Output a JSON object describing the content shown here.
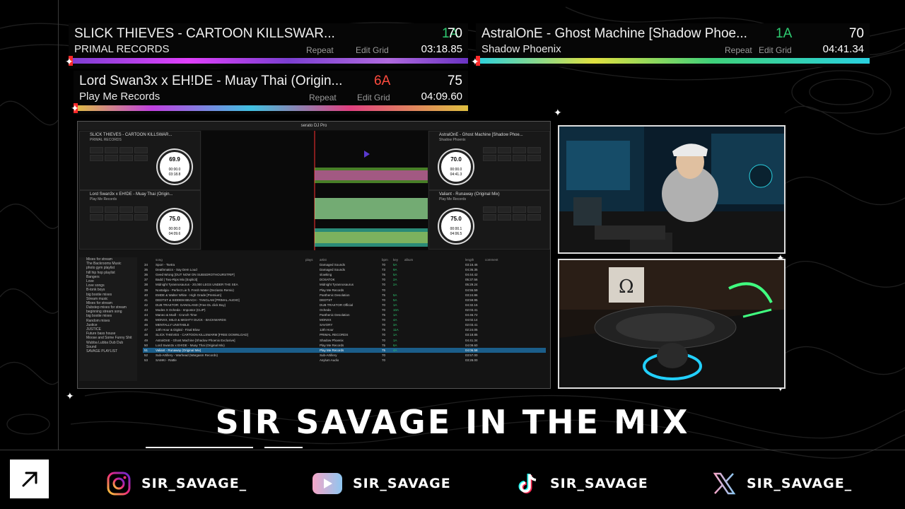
{
  "decks_overlay": [
    {
      "title": "SLICK THIEVES - CARTOON KILLSWAR...",
      "key": "1A",
      "key_color": "#2ecc71",
      "bpm": "70",
      "label": "PRIMAL RECORDS",
      "repeat": "Repeat",
      "edit_grid": "Edit Grid",
      "time": "03:18.85"
    },
    {
      "title": "AstralOnE - Ghost Machine  [Shadow Phoe...",
      "key": "1A",
      "key_color": "#2ecc71",
      "bpm": "70",
      "label": "Shadow Phoenix",
      "repeat": "Repeat",
      "edit_grid": "Edit Grid",
      "time": "04:41.34"
    },
    {
      "title": "Lord Swan3x x EH!DE - Muay Thai (Origin...",
      "key": "6A",
      "key_color": "#ff4b3e",
      "bpm": "75",
      "label": "Play Me Records",
      "repeat": "Repeat",
      "edit_grid": "Edit Grid",
      "time": "04:09.60"
    }
  ],
  "serato": {
    "app_title": "serato DJ Pro",
    "decks": [
      {
        "title": "SLICK THIEVES - CARTOON KILLSWAR...",
        "label": "PRIMAL RECORDS",
        "bpm": "70",
        "key": "1A",
        "platter_bpm": "69.9",
        "elapsed": "00:00.0",
        "remaining": "03:18.8"
      },
      {
        "title": "AstralOnE - Ghost Machine  [Shadow Phoe...",
        "label": "Shadow Phoenix",
        "bpm": "70",
        "key": "1A",
        "platter_bpm": "70.0",
        "elapsed": "00:00.0",
        "remaining": "04:41.3"
      },
      {
        "title": "Lord Swan3x x EH!DE - Muay Thai (Origin...",
        "label": "Play Me Records",
        "bpm": "75",
        "key": "6A",
        "platter_bpm": "75.0",
        "elapsed": "00:00.0",
        "remaining": "04:09.6"
      },
      {
        "title": "Valiant - Runaway (Original Mix)",
        "label": "Play Me Records",
        "bpm": "75",
        "key": "4A",
        "platter_bpm": "75.0",
        "elapsed": "00:00.1",
        "remaining": "04:06.5"
      }
    ],
    "crates": [
      "Mixes for stream",
      "The Backrooms Music",
      "photo gym playlist",
      "hill hip hop playlist",
      "Bangers",
      "Love",
      "Love songs",
      "B-tonk boys",
      "big bootie mixes",
      "Stream music",
      "Mixes for stream",
      "Dubstep mixes for stream",
      "beginning stream song",
      "big bootie mixes",
      "Random mixes",
      "Justice",
      "JUSTICE",
      "Future bass house",
      "Moose and Some Funny Shit",
      "Wubba Lubba Dub Dub",
      "Sound",
      "SAVAGE PLAYLIST"
    ],
    "columns": {
      "song": "song",
      "plays": "plays",
      "artist": "artist",
      "bpm": "bpm",
      "key": "key",
      "album": "album",
      "length": "length",
      "comment": "comment"
    },
    "tracks": [
      {
        "n": "34",
        "song": "Sporr - Tsetra",
        "artist": "Damaged Sounds",
        "bpm": "70",
        "key": "5A",
        "length": "03:16.46"
      },
      {
        "n": "35",
        "song": "Deathmatics - Say Dem Loud",
        "artist": "Damaged Sounds",
        "bpm": "73",
        "key": "9A",
        "length": "04:36.35"
      },
      {
        "n": "36",
        "song": "Geed Wrong [OUT NOW ON SUBSDROTHOURSTRIP]",
        "artist": "slowking",
        "bpm": "76",
        "key": "5A",
        "length": "04:44.42"
      },
      {
        "n": "37",
        "song": "Badd | Two-Rips Mix [Explicit]",
        "artist": "DOSATOK",
        "bpm": "70",
        "key": "2A",
        "length": "05:37.56"
      },
      {
        "n": "38",
        "song": "Midnight Tyrannosaurus - 20,000 LEGS UNDER THE SEA",
        "artist": "Midnight Tyrannosaurus",
        "bpm": "70",
        "key": "2A",
        "length": "05:29.24"
      },
      {
        "n": "39",
        "song": "Nostalgia - Perfect Lie ft. Fresh Water (Deziasto Remix)",
        "artist": "Play Me Records",
        "bpm": "70",
        "key": "",
        "length": "04:55.59"
      },
      {
        "n": "40",
        "song": "EMDE & Walter White - High Grade [Premium]",
        "artist": "Panthenic Desolation",
        "bpm": "75",
        "key": "5A",
        "length": "03:24.86"
      },
      {
        "n": "41",
        "song": "DEDTST & SIDDEM BEACH - TANGLAM [PRIMAL AUDIO]",
        "artist": "DEDTST",
        "bpm": "70",
        "key": "5A",
        "length": "03:59.95"
      },
      {
        "n": "42",
        "song": "DUB TRAKTOR: GANGLAND (Free DL click Buy)",
        "artist": "DUB TRAKTOR Official",
        "bpm": "70",
        "key": "1A",
        "length": "04:32.15"
      },
      {
        "n": "43",
        "song": "Modes X Ocheda - Impostor (CLIP)",
        "artist": "Ocheda",
        "bpm": "70",
        "key": "10A",
        "length": "02:03.41"
      },
      {
        "n": "44",
        "song": "Maneo & Modl - Crunch Time",
        "artist": "Panthenic Desolation",
        "bpm": "75",
        "key": "1A",
        "length": "04:46.72"
      },
      {
        "n": "45",
        "song": "MONXX, MILO & MIGHTY DUCK - BACKWARDS",
        "artist": "MONXX",
        "bpm": "70",
        "key": "4A",
        "length": "04:02.14"
      },
      {
        "n": "46",
        "song": "MENTALLY UNSTABLE",
        "artist": "SAVORY",
        "bpm": "70",
        "key": "3A",
        "length": "02:03.41"
      },
      {
        "n": "47",
        "song": "12th Hour & Digital - Final Blow",
        "artist": "12th Hour",
        "bpm": "75",
        "key": "11A",
        "length": "02:24.05"
      },
      {
        "n": "48",
        "song": "SLICK THIEVES - CARTOON KILLSWARM [FREE DOWNLOAD]",
        "artist": "PRIMAL RECORDS",
        "bpm": "70",
        "key": "1A",
        "length": "03:18.85"
      },
      {
        "n": "49",
        "song": "AstralOnE - Ghost Machine [Shadow Phoenix Exclusive]",
        "artist": "Shadow Phoenix",
        "bpm": "70",
        "key": "1A",
        "length": "04:41.34"
      },
      {
        "n": "50",
        "song": "Lord Swan3x x EH!DE - Muay Thai (Original Mix)",
        "artist": "Play Me Records",
        "bpm": "75",
        "key": "6A",
        "length": "04:09.60"
      },
      {
        "n": "51",
        "song": "Valiant - Runaway (Original Mix)",
        "artist": "Play Me Records",
        "bpm": "75",
        "key": "4A",
        "length": "04:06.58"
      },
      {
        "n": "52",
        "song": "Sub-Artillery - Warhead (Wargasm Records)",
        "artist": "Sub-Artillery",
        "bpm": "70",
        "key": "",
        "length": "03:57.00"
      },
      {
        "n": "53",
        "song": "SAMKI - Rattle",
        "artist": "Asylum Audio",
        "bpm": "70",
        "key": "",
        "length": "03:28.00"
      }
    ],
    "active_track_index": 17
  },
  "headline": "SIR SAVAGE IN THE MIX",
  "socials": [
    {
      "platform_icon": "instagram-icon",
      "handle": "SIR_SAVAGE_"
    },
    {
      "platform_icon": "youtube-icon",
      "handle": "SIR_SAVAGE"
    },
    {
      "platform_icon": "tiktok-icon",
      "handle": "SIR_SAVAGE"
    },
    {
      "platform_icon": "x-icon",
      "handle": "SIR_SAVAGE_"
    }
  ],
  "colors": {
    "background": "#000000",
    "accent_green": "#2ecc71",
    "accent_red": "#ff4b3e",
    "serato_blue": "#1b5e8a"
  }
}
